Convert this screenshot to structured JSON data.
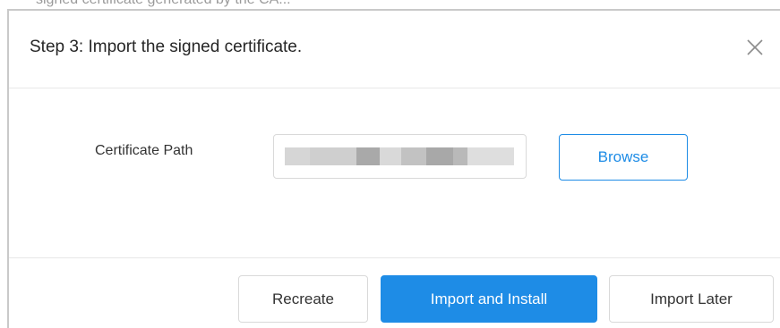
{
  "background_text": "signed certificate generated by the CA...",
  "dialog": {
    "title": "Step 3: Import the signed certificate.",
    "close_icon": "close-icon"
  },
  "form": {
    "certificate_path_label": "Certificate Path",
    "certificate_path_value": "",
    "browse_label": "Browse"
  },
  "footer": {
    "recreate_label": "Recreate",
    "import_install_label": "Import and Install",
    "import_later_label": "Import Later"
  },
  "colors": {
    "primary": "#1e8ce6",
    "border": "#d9d9d9",
    "text": "#333333"
  }
}
